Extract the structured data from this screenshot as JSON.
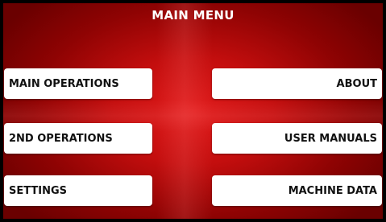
{
  "header": {
    "title": "MAIN MENU"
  },
  "menu": {
    "left": [
      {
        "label": "MAIN OPERATIONS"
      },
      {
        "label": "2ND OPERATIONS"
      },
      {
        "label": "SETTINGS"
      }
    ],
    "right": [
      {
        "label": "ABOUT"
      },
      {
        "label": "USER MANUALS"
      },
      {
        "label": "MACHINE DATA"
      }
    ]
  },
  "colors": {
    "background_center": "#e01a1a",
    "background_edge": "#6a0000",
    "button": "#ffffff",
    "button_text": "#111111",
    "title_text": "#ffffff"
  }
}
